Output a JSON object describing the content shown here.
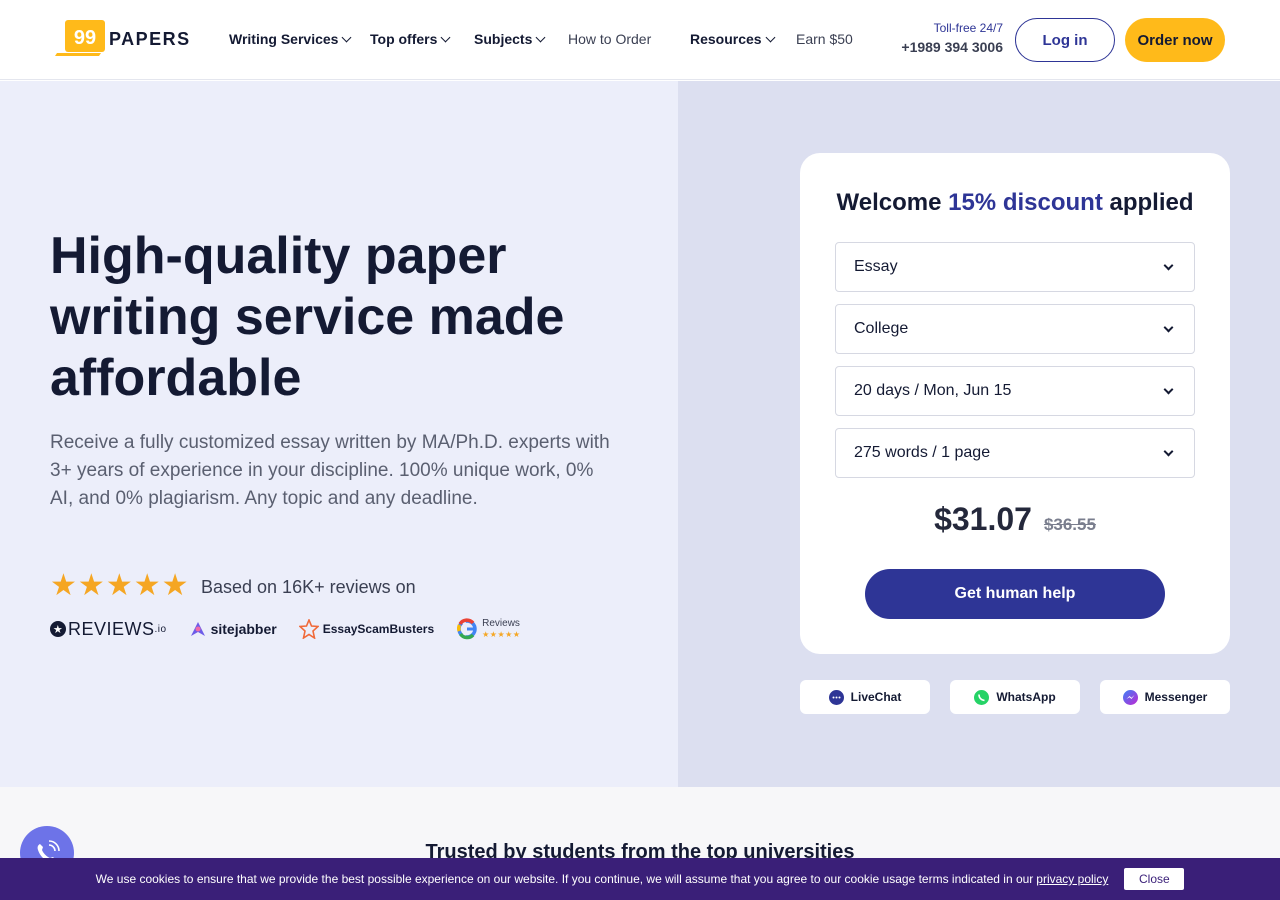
{
  "brand": {
    "name": "PAPERS",
    "logo_glyph": "99"
  },
  "nav": {
    "writing_services": "Writing Services",
    "top_offers": "Top offers",
    "subjects": "Subjects",
    "how_to_order": "How to Order",
    "resources": "Resources",
    "earn": "Earn $50"
  },
  "contact": {
    "tollfree": "Toll-free 24/7",
    "phone": "+1989 394 3006"
  },
  "header_buttons": {
    "login": "Log in",
    "order": "Order now"
  },
  "hero": {
    "title": "High-quality paper writing service made affordable",
    "subtitle": "Receive a fully customized essay written by MA/Ph.D. experts with 3+ years of experience in your discipline. 100% unique work, 0% AI, and 0% plagiarism. Any topic and any deadline.",
    "rating_stars": 5,
    "reviews_text": "Based on 16K+ reviews on",
    "review_sites": {
      "reviewsio": "REVIEWS",
      "reviewsio_suffix": ".io",
      "sitejabber": "sitejabber",
      "essayscambusters": "EssayScamBusters",
      "google_label": "Reviews",
      "google_stars": "★★★★★"
    }
  },
  "order_card": {
    "title_prefix": "Welcome ",
    "title_accent": "15% discount",
    "title_suffix": " applied",
    "paper_type": "Essay",
    "level": "College",
    "deadline": "20 days / Mon, Jun 15",
    "pages": "275 words / 1 page",
    "price": "$31.07",
    "old_price": "$36.55",
    "cta": "Get human help"
  },
  "chat": {
    "livechat": "LiveChat",
    "whatsapp": "WhatsApp",
    "messenger": "Messenger"
  },
  "trusted": {
    "title": "Trusted by students from the top universities"
  },
  "cookie": {
    "text": "We use cookies to ensure that we provide the best possible experience on our website. If you continue, we will assume that you agree to our cookie usage terms indicated in our",
    "link": "privacy policy",
    "close": "Close"
  },
  "colors": {
    "primary": "#2e3596",
    "accent_yellow": "#ffba1a",
    "hero_left_bg": "#eceefa",
    "hero_right_bg": "#dcdff0",
    "cookie_bg": "#3a1f78",
    "star": "#f5a623"
  }
}
